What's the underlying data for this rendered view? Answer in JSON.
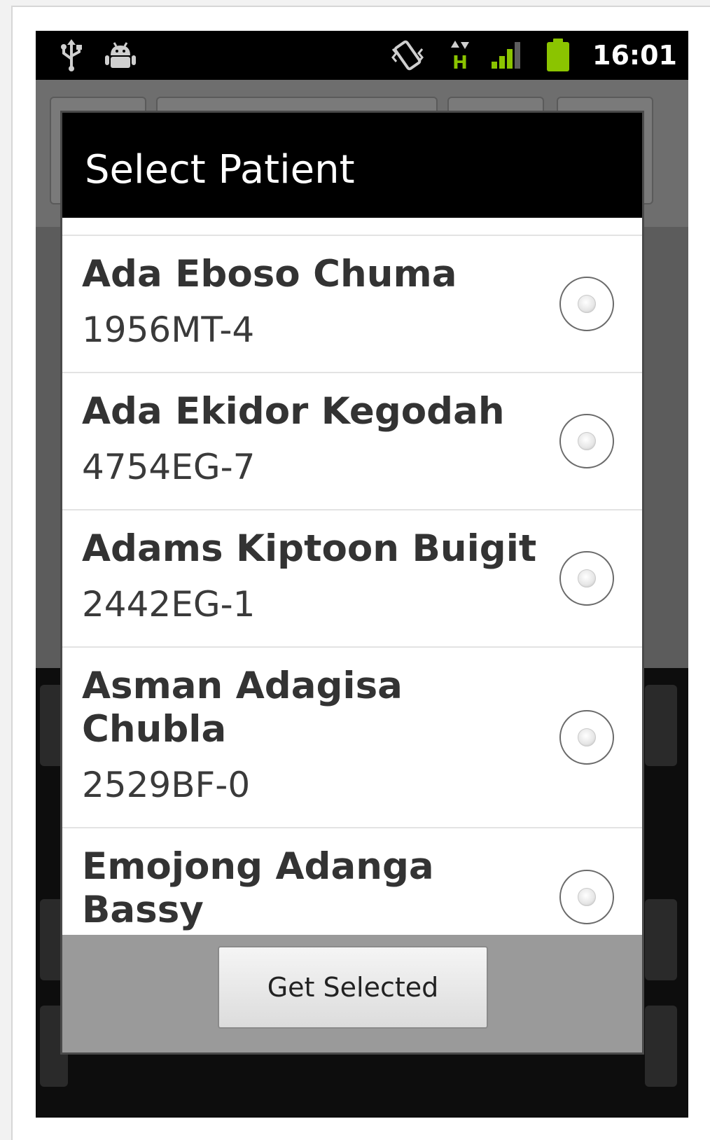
{
  "status_bar": {
    "time": "16:01",
    "icons": [
      "usb-icon",
      "android-debug-icon",
      "vibrate-icon",
      "network-activity-icon",
      "signal-icon",
      "battery-icon"
    ],
    "network_label": "H"
  },
  "colors": {
    "accent_green": "#8bc400",
    "dialog_header": "#000000",
    "list_background": "#ffffff"
  },
  "dialog": {
    "title": "Select Patient",
    "patients": [
      {
        "name": "Ada Eboso Chuma",
        "id": "1956MT-4"
      },
      {
        "name": "Ada Ekidor Kegodah",
        "id": "4754EG-7"
      },
      {
        "name": "Adams Kiptoon Buigit",
        "id": "2442EG-1"
      },
      {
        "name": "Asman Adagisa Chubla",
        "id": "2529BF-0"
      },
      {
        "name": "Emojong Adanga Bassy",
        "id": ""
      }
    ],
    "button_label": "Get Selected"
  }
}
